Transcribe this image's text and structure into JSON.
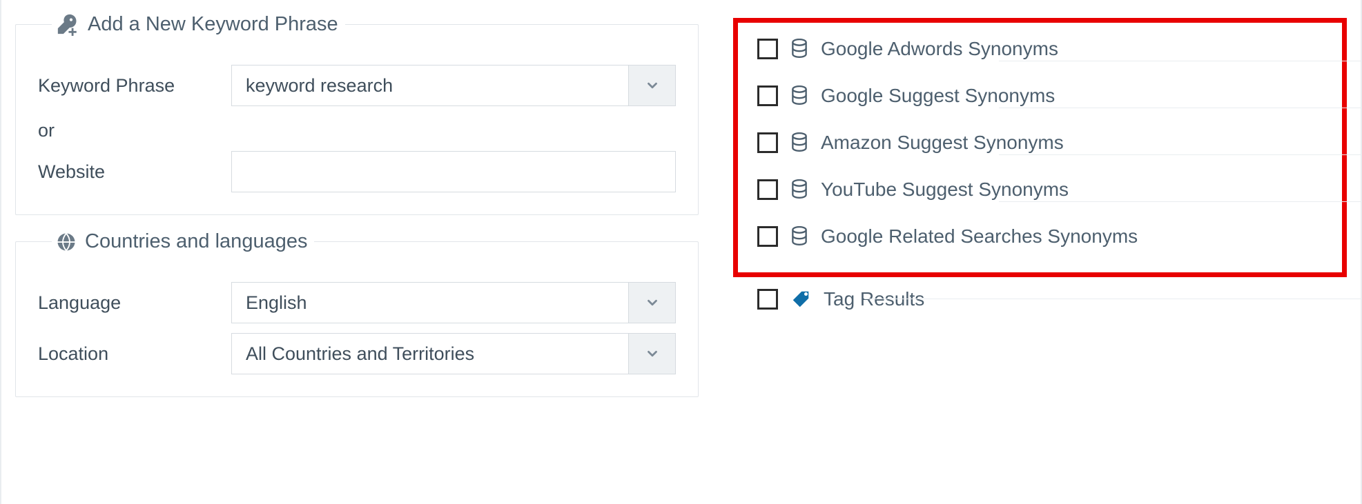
{
  "panels": {
    "keyword": {
      "legend": "Add a New Keyword Phrase",
      "phrase_label": "Keyword Phrase",
      "phrase_value": "keyword research",
      "or_label": "or",
      "website_label": "Website",
      "website_value": ""
    },
    "locale": {
      "legend": "Countries and languages",
      "language_label": "Language",
      "language_value": "English",
      "location_label": "Location",
      "location_value": "All Countries and Territories"
    }
  },
  "synonym_sources": [
    {
      "label": "Google Adwords Synonyms",
      "checked": false
    },
    {
      "label": "Google Suggest Synonyms",
      "checked": false
    },
    {
      "label": "Amazon Suggest Synonyms",
      "checked": false
    },
    {
      "label": "YouTube Suggest Synonyms",
      "checked": false
    },
    {
      "label": "Google Related Searches Synonyms",
      "checked": false
    }
  ],
  "tag_results": {
    "label": "Tag Results",
    "checked": false
  }
}
